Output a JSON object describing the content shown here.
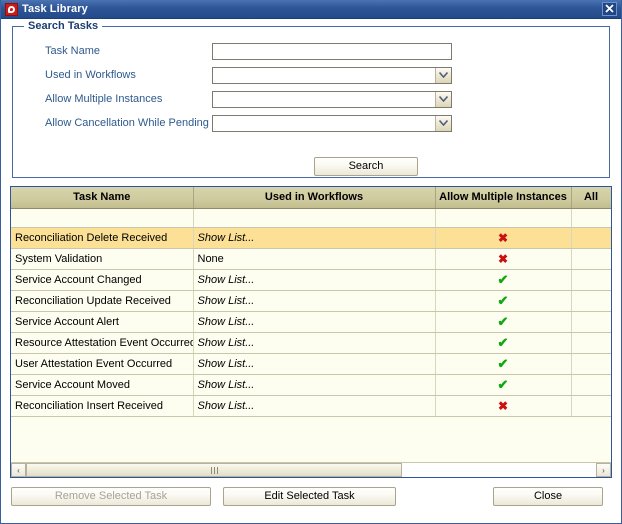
{
  "window": {
    "title": "Task Library",
    "app_icon": "red-square-icon",
    "close_icon": "close-icon"
  },
  "search_panel": {
    "legend": "Search Tasks",
    "fields": [
      {
        "label": "Task Name",
        "type": "text",
        "value": "",
        "placeholder": ""
      },
      {
        "label": "Used in Workflows",
        "type": "combo",
        "value": ""
      },
      {
        "label": "Allow Multiple Instances",
        "type": "combo",
        "value": ""
      },
      {
        "label": "Allow Cancellation While Pending",
        "type": "combo",
        "value": ""
      }
    ],
    "search_button": "Search"
  },
  "table": {
    "columns": [
      {
        "key": "task_name",
        "label": "Task Name"
      },
      {
        "key": "workflows",
        "label": "Used in Workflows"
      },
      {
        "key": "multiple",
        "label": "Allow Multiple Instances"
      },
      {
        "key": "cancel",
        "label": "All"
      }
    ],
    "filter_row": {
      "task_name": "",
      "workflows": "",
      "multiple": "",
      "cancel": ""
    },
    "rows": [
      {
        "task_name": "Reconciliation Delete Received",
        "workflows": "Show List...",
        "workflows_italic": true,
        "multiple": "x",
        "cancel": "",
        "selected": true
      },
      {
        "task_name": "System Validation",
        "workflows": "None",
        "workflows_italic": false,
        "multiple": "x",
        "cancel": "",
        "selected": false
      },
      {
        "task_name": "Service Account Changed",
        "workflows": "Show List...",
        "workflows_italic": true,
        "multiple": "v",
        "cancel": "",
        "selected": false
      },
      {
        "task_name": "Reconciliation Update Received",
        "workflows": "Show List...",
        "workflows_italic": true,
        "multiple": "v",
        "cancel": "",
        "selected": false
      },
      {
        "task_name": "Service Account Alert",
        "workflows": "Show List...",
        "workflows_italic": true,
        "multiple": "v",
        "cancel": "",
        "selected": false
      },
      {
        "task_name": "Resource Attestation Event Occurred",
        "workflows": "Show List...",
        "workflows_italic": true,
        "multiple": "v",
        "cancel": "",
        "selected": false
      },
      {
        "task_name": "User Attestation Event Occurred",
        "workflows": "Show List...",
        "workflows_italic": true,
        "multiple": "v",
        "cancel": "",
        "selected": false
      },
      {
        "task_name": "Service Account Moved",
        "workflows": "Show List...",
        "workflows_italic": true,
        "multiple": "v",
        "cancel": "",
        "selected": false
      },
      {
        "task_name": "Reconciliation Insert Received",
        "workflows": "Show List...",
        "workflows_italic": true,
        "multiple": "x",
        "cancel": "",
        "selected": false
      }
    ],
    "marks": {
      "x": "✖",
      "v": "✔"
    },
    "scrollbar": {
      "left_arrow": "‹",
      "right_arrow": "›",
      "thumb_percent": 66
    }
  },
  "footer": {
    "remove_button": "Remove Selected Task",
    "remove_disabled": true,
    "edit_button": "Edit Selected Task",
    "close_button": "Close"
  },
  "colors": {
    "titlebar": "#2e5596",
    "accent_border": "#2c5699",
    "label_text": "#2e5a8e",
    "header_bg": "#cfcb9f",
    "row_bg": "#fdfdf0",
    "selected_row": "#fbe096",
    "mark_x": "#cc1111",
    "mark_v": "#10a810"
  }
}
